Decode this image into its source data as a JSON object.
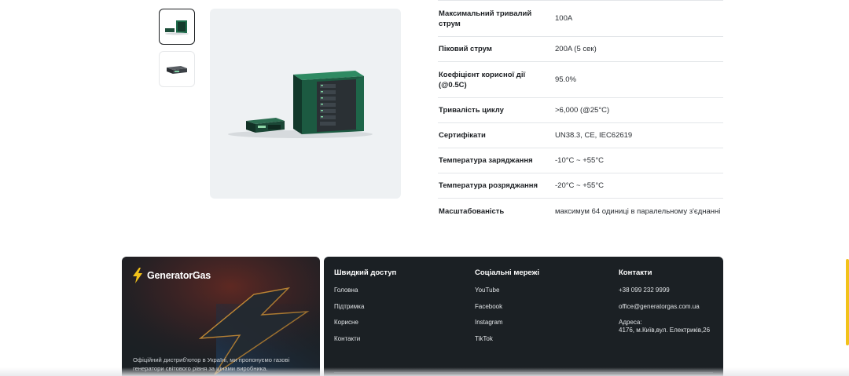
{
  "gallery": {
    "thumbnails": [
      {
        "icon": "battery-rack-thumbnail-icon",
        "selected": true
      },
      {
        "icon": "battery-module-thumbnail-icon",
        "selected": false
      }
    ],
    "main_image_icon": "battery-rack-product-image"
  },
  "specs": [
    {
      "label": "Максимальний тривалий струм",
      "value": "100A"
    },
    {
      "label": "Піковий струм",
      "value": "200A (5 сек)"
    },
    {
      "label": "Коефіцієнт корисної дії (@0.5C)",
      "value": "95.0%"
    },
    {
      "label": "Тривалість циклу",
      "value": ">6,000 (@25°C)"
    },
    {
      "label": "Сертифікати",
      "value": "UN38.3, CE, IEC62619"
    },
    {
      "label": "Температура заряджання",
      "value": "-10°C ~ +55°C"
    },
    {
      "label": "Температура розряджання",
      "value": "-20°C ~ +55°C"
    },
    {
      "label": "Масштабованість",
      "value": "максимум 64 одиниці в паралельному з'єднанні"
    }
  ],
  "footer": {
    "brand": {
      "logo_text": "GeneratorGas",
      "logo_icon": "lightning-bolt-icon",
      "description": "Офіційний дистриб'ютор в Україні, ми пропонуємо газові генератори світового рівня за цінами виробника."
    },
    "quick_access": {
      "title": "Швидкий доступ",
      "links": [
        "Головна",
        "Підтримка",
        "Корисне",
        "Контакти"
      ]
    },
    "social": {
      "title": "Соціальні мережі",
      "links": [
        "YouTube",
        "Facebook",
        "Instagram",
        "TikTok"
      ]
    },
    "contacts": {
      "title": "Контакти",
      "phone": "+38 099 232 9999",
      "email": "office@generatorgas.com.ua",
      "address_label": "Адреса:",
      "address": "4176, м.Київ,вул. Електриків,26"
    }
  },
  "colors": {
    "footer_bg": "#1b2024",
    "accent": "#f2c21a",
    "battery_green": "#1f7a52"
  }
}
